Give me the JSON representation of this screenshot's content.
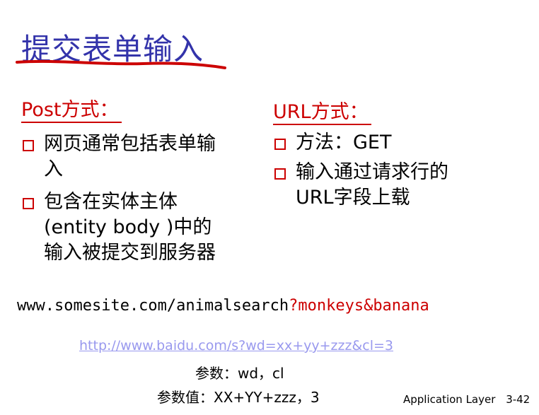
{
  "slide": {
    "title": "提交表单输入"
  },
  "left": {
    "heading": "Post方式：",
    "bullets": [
      {
        "line1": "网页通常包括表单输",
        "line2": "入"
      },
      {
        "line1": "包含在实体主体",
        "line2": "(entity body )中的",
        "line3": "输入被提交到服务器"
      }
    ]
  },
  "right": {
    "heading": "URL方式：",
    "bullets": [
      {
        "line1": "方法：GET"
      },
      {
        "line1": "输入通过请求行的",
        "line2": "URL字段上载"
      }
    ]
  },
  "example": {
    "url_base": "www.somesite.com/animalsearch",
    "url_query": "?monkeys&banana",
    "link": "http://www.baidu.com/s?wd=xx+yy+zzz&cl=3",
    "params": "参数：wd，cl",
    "param_values": "参数值：XX+YY+zzz，3"
  },
  "footer": {
    "label": "Application Layer",
    "page": "3-42"
  },
  "colors": {
    "title": "#3333aa",
    "accent": "#cc0000",
    "link": "#9999ee"
  }
}
